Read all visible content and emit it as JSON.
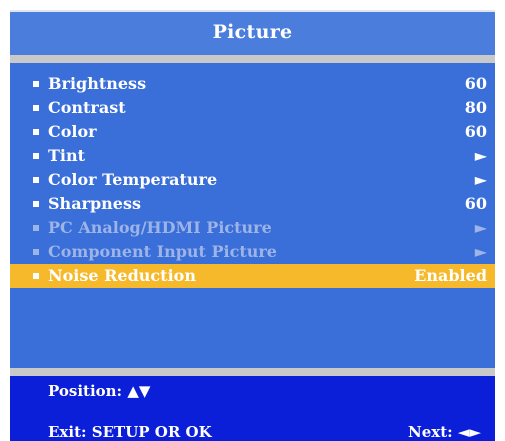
{
  "menu": {
    "title": "Picture",
    "items": [
      {
        "label": "Brightness",
        "value": "60",
        "state": "normal"
      },
      {
        "label": "Contrast",
        "value": "80",
        "state": "normal"
      },
      {
        "label": "Color",
        "value": "60",
        "state": "normal"
      },
      {
        "label": "Tint",
        "value": "►",
        "state": "normal",
        "value_icon": "submenu-arrow-icon"
      },
      {
        "label": "Color Temperature",
        "value": "►",
        "state": "normal",
        "value_icon": "submenu-arrow-icon"
      },
      {
        "label": "Sharpness",
        "value": "60",
        "state": "normal"
      },
      {
        "label": "PC Analog/HDMI Picture",
        "value": "►",
        "state": "disabled",
        "value_icon": "submenu-arrow-icon"
      },
      {
        "label": "Component Input Picture",
        "value": "►",
        "state": "disabled",
        "value_icon": "submenu-arrow-icon"
      },
      {
        "label": "Noise Reduction",
        "value": "Enabled",
        "state": "selected"
      }
    ]
  },
  "footer": {
    "position_label": "Position: ▲▼",
    "exit_label": "Exit: SETUP OR OK",
    "next_label": "Next: ◄►"
  },
  "colors": {
    "panel": "#3a6ed8",
    "title_bar": "#4a7ddc",
    "separator": "#c9c9c9",
    "highlight": "#f6b92b",
    "disabled_text": "#9db4e6",
    "footer": "#0b1fd8"
  }
}
